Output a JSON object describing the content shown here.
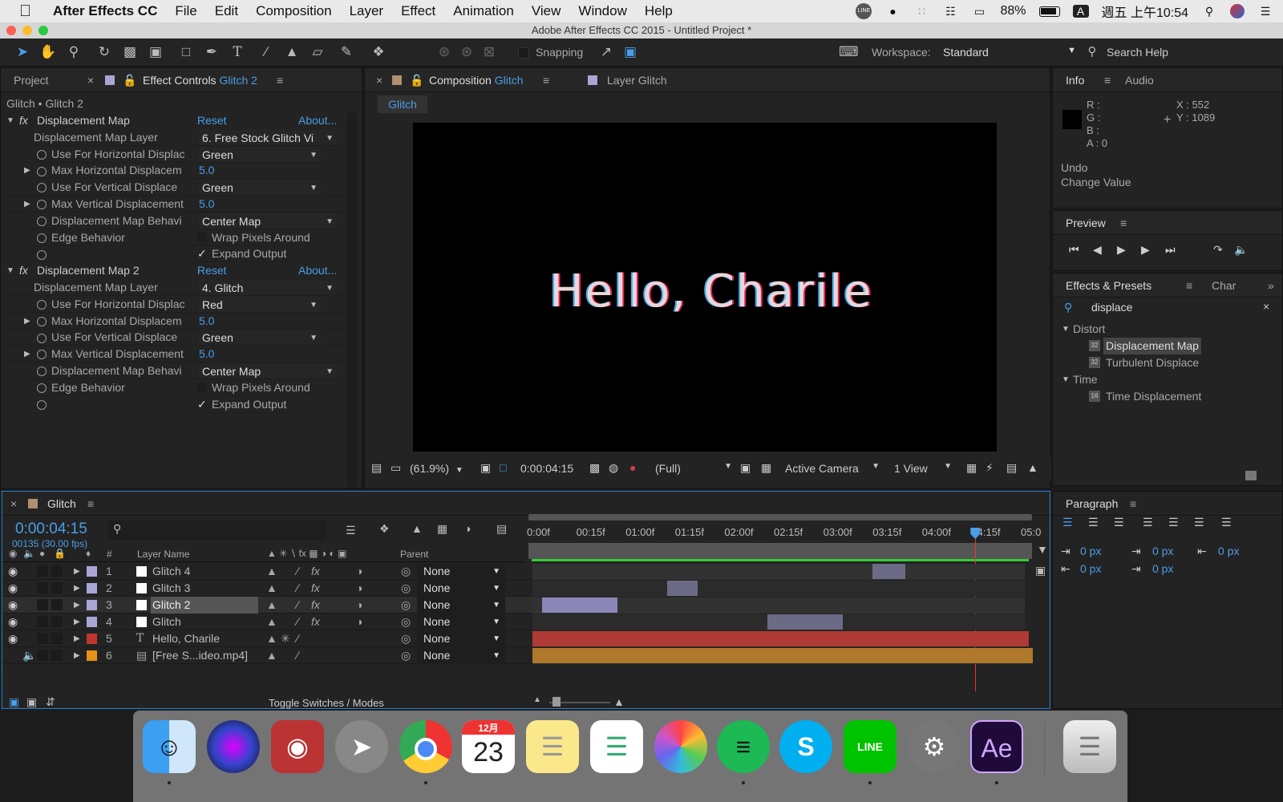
{
  "menubar": {
    "app_name": "After Effects CC",
    "menus": [
      "File",
      "Edit",
      "Composition",
      "Layer",
      "Effect",
      "Animation",
      "View",
      "Window",
      "Help"
    ],
    "battery": "88%",
    "input_indicator": "A",
    "clock": "週五 上午10:54",
    "line_badge": "LINE"
  },
  "window": {
    "title": "Adobe After Effects CC 2015 - Untitled Project *"
  },
  "toolbar": {
    "snapping_label": "Snapping",
    "workspace_label": "Workspace:",
    "workspace_value": "Standard",
    "search_help": "Search Help"
  },
  "left_panel": {
    "tab_project": "Project",
    "tab_effect_controls": "Effect Controls",
    "tab_effect_layer": "Glitch 2",
    "breadcrumb": "Glitch • Glitch 2",
    "effects": [
      {
        "name": "Displacement Map",
        "reset": "Reset",
        "about": "About...",
        "props": [
          {
            "label": "Displacement Map Layer",
            "value": "6. Free Stock Glitch Vi"
          },
          {
            "label": "Use For Horizontal Displac",
            "value": "Green"
          },
          {
            "label": "Max Horizontal Displacem",
            "value": "5.0"
          },
          {
            "label": "Use For Vertical Displace",
            "value": "Green"
          },
          {
            "label": "Max Vertical Displacement",
            "value": "5.0"
          },
          {
            "label": "Displacement Map Behavi",
            "value": "Center Map"
          },
          {
            "label": "Edge Behavior",
            "value": "Wrap Pixels Around"
          },
          {
            "label": "",
            "value": "Expand Output"
          }
        ]
      },
      {
        "name": "Displacement Map 2",
        "reset": "Reset",
        "about": "About...",
        "props": [
          {
            "label": "Displacement Map Layer",
            "value": "4. Glitch"
          },
          {
            "label": "Use For Horizontal Displac",
            "value": "Red"
          },
          {
            "label": "Max Horizontal Displacem",
            "value": "5.0"
          },
          {
            "label": "Use For Vertical Displace",
            "value": "Green"
          },
          {
            "label": "Max Vertical Displacement",
            "value": "5.0"
          },
          {
            "label": "Displacement Map Behavi",
            "value": "Center Map"
          },
          {
            "label": "Edge Behavior",
            "value": "Wrap Pixels Around"
          },
          {
            "label": "",
            "value": "Expand Output"
          }
        ]
      }
    ],
    "checkmark": "✓"
  },
  "comp_panel": {
    "tab_composition": "Composition",
    "tab_comp_name": "Glitch",
    "tab_layer": "Layer Glitch",
    "flow_label": "Glitch",
    "canvas_text": "Hello, Charile",
    "zoom": "(61.9%)",
    "timecode": "0:00:04:15",
    "resolution": "(Full)",
    "camera": "Active Camera",
    "views": "1 View"
  },
  "right_panel": {
    "info_tab": "Info",
    "audio_tab": "Audio",
    "r": "R :",
    "g": "G :",
    "b": "B :",
    "a": "A : 0",
    "x": "X : 552",
    "y": "Y : 1089",
    "undo": "Undo",
    "change": "Change Value",
    "preview_tab": "Preview",
    "effects_tab": "Effects & Presets",
    "char_tab": "Char",
    "search_value": "displace",
    "tree": [
      {
        "type": "group",
        "label": "Distort"
      },
      {
        "type": "item",
        "label": "Displacement Map",
        "badge": "32",
        "selected": true
      },
      {
        "type": "item",
        "label": "Turbulent Displace",
        "badge": "32"
      },
      {
        "type": "group",
        "label": "Time"
      },
      {
        "type": "item",
        "label": "Time Displacement",
        "badge": "16"
      }
    ],
    "paragraph_tab": "Paragraph",
    "indent_values": [
      "0 px",
      "0 px",
      "0 px",
      "0 px",
      "0 px"
    ]
  },
  "timeline": {
    "tab_name": "Glitch",
    "timecode": "0:00:04:15",
    "frames": "00135 (30.00 fps)",
    "search_placeholder": "",
    "col_hash": "#",
    "col_layer_name": "Layer Name",
    "col_parent": "Parent",
    "ruler": [
      "0:00f",
      "00:15f",
      "01:00f",
      "01:15f",
      "02:00f",
      "02:15f",
      "03:00f",
      "03:15f",
      "04:00f",
      "04:15f",
      "05:0"
    ],
    "layers": [
      {
        "num": "1",
        "name": "Glitch 4",
        "parent": "None",
        "color": "#a9a6d6",
        "fx": "fx",
        "bar_start": 0.68,
        "bar_end": 0.745,
        "bar_color": "#6b6b85"
      },
      {
        "num": "2",
        "name": "Glitch 3",
        "parent": "None",
        "color": "#a9a6d6",
        "fx": "fx",
        "bar_start": 0.27,
        "bar_end": 0.33,
        "bar_color": "#6b6b85"
      },
      {
        "num": "3",
        "name": "Glitch 2",
        "parent": "None",
        "color": "#a9a6d6",
        "fx": "fx",
        "bar_start": 0.02,
        "bar_end": 0.17,
        "bar_color": "#8a87b8",
        "selected": true
      },
      {
        "num": "4",
        "name": "Glitch",
        "parent": "None",
        "color": "#a9a6d6",
        "fx": "fx",
        "bar_start": 0.47,
        "bar_end": 0.62,
        "bar_color": "#6b6b85"
      },
      {
        "num": "5",
        "name": "Hello, Charile",
        "parent": "None",
        "color": "#c0352e",
        "fx": "",
        "bar_start": 0.0,
        "bar_end": 0.992,
        "bar_color": "#b03a36"
      },
      {
        "num": "6",
        "name": "[Free S...ideo.mp4]",
        "parent": "None",
        "color": "#e8901c",
        "fx": "",
        "bar_start": 0.0,
        "bar_end": 1.0,
        "bar_color": "#b0782a"
      }
    ],
    "playhead": 0.885,
    "toggle_label": "Toggle Switches / Modes"
  },
  "dock": {
    "calendar_month": "12月",
    "calendar_day": "23",
    "ae_label": "Ae",
    "line_label": "LINE"
  }
}
